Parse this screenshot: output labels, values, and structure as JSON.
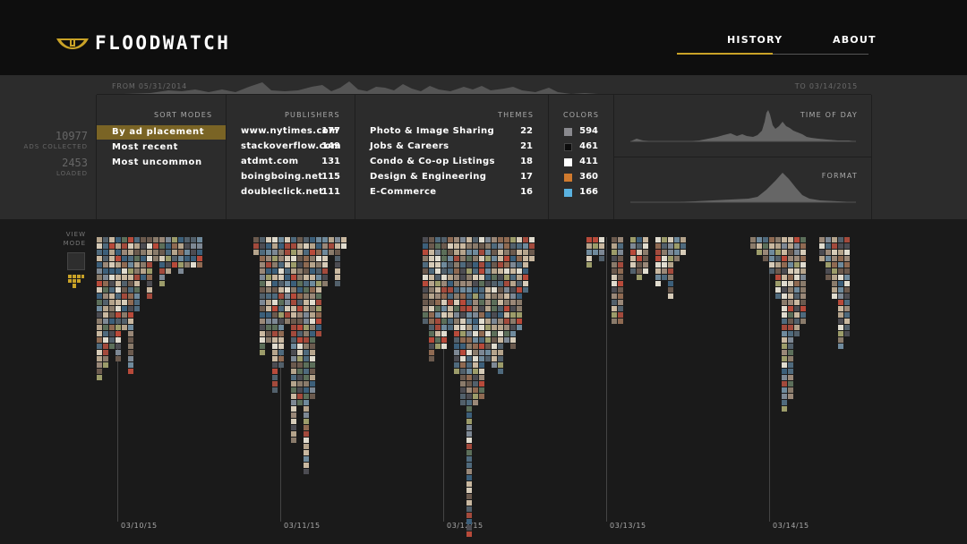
{
  "app": {
    "title": "FLOODWATCH"
  },
  "nav": {
    "history": "HISTORY",
    "about": "ABOUT",
    "active": "history",
    "accent_color": "#c9a227"
  },
  "timeline": {
    "from": "FROM 05/31/2014",
    "to": "TO 03/14/2015"
  },
  "stats": {
    "ads_collected_value": "10977",
    "ads_collected_label": "ADS COLLECTED",
    "loaded_value": "2453",
    "loaded_label": "LOADED"
  },
  "sort_modes": {
    "title": "SORT MODES",
    "items": [
      "By ad placement",
      "Most recent",
      "Most uncommon"
    ],
    "active_index": 0
  },
  "publishers": {
    "title": "PUBLISHERS",
    "rows": [
      {
        "name": "www.nytimes.com",
        "count": "177"
      },
      {
        "name": "stackoverflow.com",
        "count": "149"
      },
      {
        "name": "atdmt.com",
        "count": "131"
      },
      {
        "name": "boingboing.net",
        "count": "115"
      },
      {
        "name": "doubleclick.net",
        "count": "111"
      }
    ]
  },
  "themes": {
    "title": "THEMES",
    "rows": [
      {
        "name": "Photo & Image Sharing",
        "count": "22"
      },
      {
        "name": "Jobs & Careers",
        "count": "21"
      },
      {
        "name": "Condo & Co-op Listings",
        "count": "18"
      },
      {
        "name": "Design & Engineering",
        "count": "17"
      },
      {
        "name": "E-Commerce",
        "count": "16"
      }
    ]
  },
  "colors": {
    "title": "COLORS",
    "rows": [
      {
        "color": "#8a8a8f",
        "count": "594"
      },
      {
        "color": "#0c0c0c",
        "count": "461"
      },
      {
        "color": "#ffffff",
        "count": "411"
      },
      {
        "color": "#d07a2e",
        "count": "360"
      },
      {
        "color": "#5ab2e0",
        "count": "166"
      }
    ]
  },
  "time_of_day": {
    "title": "TIME OF DAY"
  },
  "format": {
    "title": "FORMAT"
  },
  "view_mode": {
    "label_line1": "VIEW",
    "label_line2": "MODE",
    "options": [
      "list-view-icon",
      "grid-view-icon"
    ],
    "active": "grid-view-icon"
  },
  "days": [
    {
      "date": "03/10/15"
    },
    {
      "date": "03/11/15"
    },
    {
      "date": "03/12/15"
    },
    {
      "date": "03/13/15"
    },
    {
      "date": "03/14/15"
    }
  ]
}
